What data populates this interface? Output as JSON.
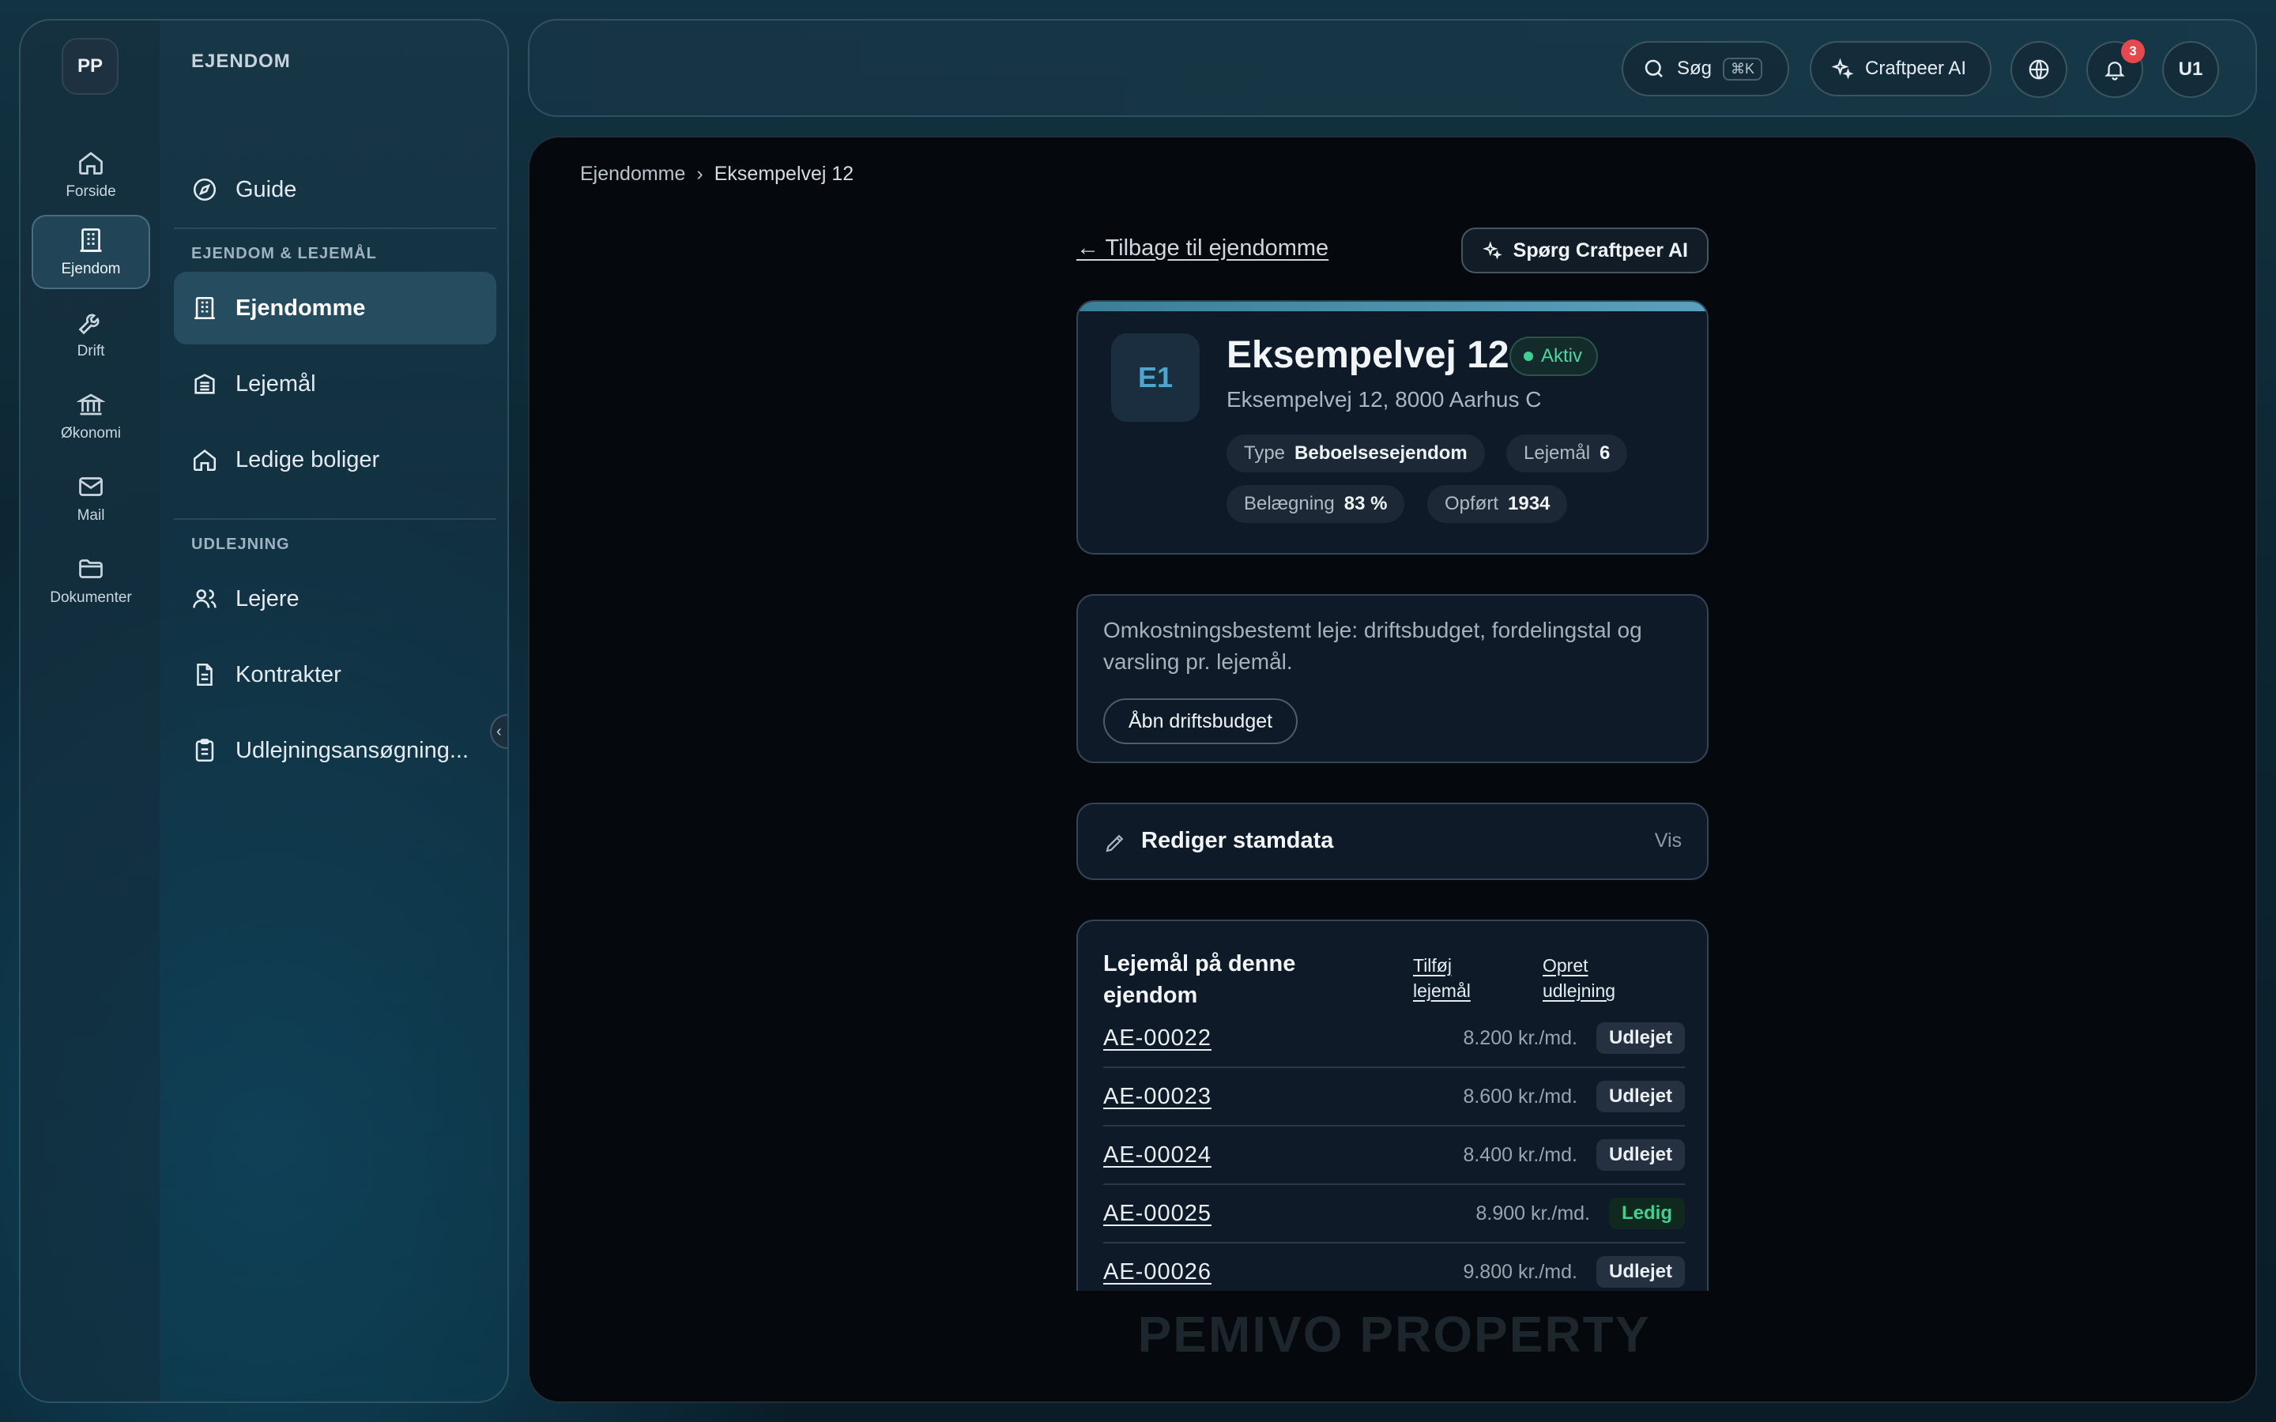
{
  "sidebar": {
    "avatar_initials": "PP",
    "rail": [
      {
        "label": "Forside",
        "icon": "home-icon"
      },
      {
        "label": "Ejendom",
        "icon": "building-icon",
        "active": true
      },
      {
        "label": "Drift",
        "icon": "wrench-icon"
      },
      {
        "label": "Økonomi",
        "icon": "bank-icon"
      },
      {
        "label": "Mail",
        "icon": "mail-icon"
      },
      {
        "label": "Dokumenter",
        "icon": "folder-icon"
      }
    ],
    "panel_title": "EJENDOM",
    "guide_label": "Guide",
    "section1_title": "EJENDOM & LEJEMÅL",
    "section1_items": [
      {
        "label": "Ejendomme",
        "icon": "building-icon",
        "active": true
      },
      {
        "label": "Lejemål",
        "icon": "apartment-icon"
      },
      {
        "label": "Ledige boliger",
        "icon": "home-icon"
      }
    ],
    "section2_title": "UDLEJNING",
    "section2_items": [
      {
        "label": "Lejere",
        "icon": "users-icon"
      },
      {
        "label": "Kontrakter",
        "icon": "document-icon"
      },
      {
        "label": "Udlejningsansøgning...",
        "icon": "clipboard-icon"
      }
    ]
  },
  "topbar": {
    "search_label": "Søg",
    "search_shortcut": "⌘K",
    "ai_label": "Craftpeer AI",
    "notification_count": "3",
    "user_initials": "U1"
  },
  "breadcrumb": {
    "root": "Ejendomme",
    "current": "Eksempelvej 12"
  },
  "main": {
    "back_link": "← Tilbage til ejendomme",
    "ask_ai_label": "Spørg Craftpeer AI",
    "property": {
      "code": "E1",
      "title": "Eksempelvej 12",
      "status": "Aktiv",
      "address": "Eksempelvej 12, 8000 Aarhus C",
      "type_label": "Type",
      "type_value": "Beboelsesejendom",
      "units_label": "Lejemål",
      "units_value": "6",
      "occupancy_label": "Belægning",
      "occupancy_value": "83 %",
      "built_label": "Opført",
      "built_value": "1934"
    },
    "info": {
      "text": "Omkostningsbestemt leje: driftsbudget, fordelingstal og varsling pr. lejemål.",
      "button": "Åbn driftsbudget"
    },
    "edit": {
      "title": "Rediger stamdata",
      "toggle": "Vis"
    },
    "leases": {
      "title": "Lejemål på denne ejendom",
      "add_link": "Tilføj lejemål",
      "create_link": "Opret udlejning",
      "rows": [
        {
          "id": "AE-00022",
          "rent": "8.200 kr./md.",
          "status": "Udlejet",
          "kind": "udlejet"
        },
        {
          "id": "AE-00023",
          "rent": "8.600 kr./md.",
          "status": "Udlejet",
          "kind": "udlejet"
        },
        {
          "id": "AE-00024",
          "rent": "8.400 kr./md.",
          "status": "Udlejet",
          "kind": "udlejet"
        },
        {
          "id": "AE-00025",
          "rent": "8.900 kr./md.",
          "status": "Ledig",
          "kind": "ledig"
        },
        {
          "id": "AE-00026",
          "rent": "9.800 kr./md.",
          "status": "Udlejet",
          "kind": "udlejet"
        }
      ]
    },
    "brand": "PEMIVO PROPERTY"
  }
}
